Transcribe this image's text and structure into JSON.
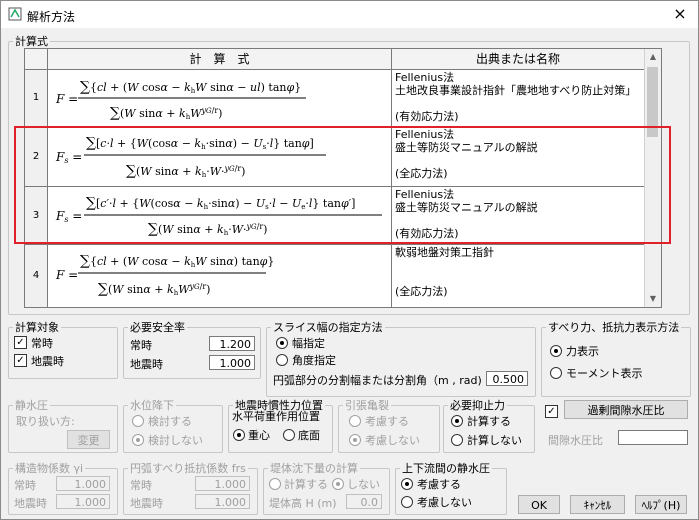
{
  "window": {
    "title": "解析方法",
    "close_symbol": "×"
  },
  "formula_group": {
    "legend": "計算式",
    "col_formula": "計　算　式",
    "col_source": "出典または名称",
    "rows": [
      {
        "no": "1",
        "source": [
          "Fellenius法",
          "土地改良事業設計指針「農地地すべり防止対策」",
          "",
          "(有効応力法)"
        ]
      },
      {
        "no": "2",
        "source": [
          "Fellenius法",
          "盛土等防災マニュアルの解説",
          "",
          "(全応力法)"
        ]
      },
      {
        "no": "3",
        "source": [
          "Fellenius法",
          "盛土等防災マニュアルの解説",
          "",
          "(有効応力法)"
        ]
      },
      {
        "no": "4",
        "source": [
          "軟弱地盤対策工指針",
          "",
          "",
          "(全応力法)"
        ]
      }
    ]
  },
  "target": {
    "legend": "計算対象",
    "normal": "常時",
    "quake": "地震時",
    "normal_checked": true,
    "quake_checked": true
  },
  "safety": {
    "legend": "必要安全率",
    "normal": "常時",
    "normal_value": "1.200",
    "quake": "地震時",
    "quake_value": "1.000"
  },
  "slice": {
    "legend": "スライス幅の指定方法",
    "opt1": "幅指定",
    "opt2": "角度指定",
    "arc_label": "円弧部分の分割幅または分割角（m , rad)",
    "arc_value": "0.500"
  },
  "display": {
    "legend": "すべり力、抵抗力表示方法",
    "opt1": "力表示",
    "opt2": "モーメント表示"
  },
  "static_water": {
    "legend": "静水圧",
    "label": "取り扱い方:",
    "button": "変更"
  },
  "water_drop": {
    "legend": "水位降下",
    "opt1": "検討する",
    "opt2": "検討しない"
  },
  "inertia": {
    "legend": "地震時慣性力位置",
    "sub": "水平荷重作用位置",
    "opt1": "重心",
    "opt2": "底面"
  },
  "tension_crack": {
    "legend": "引張亀裂",
    "opt1": "考慮する",
    "opt2": "考慮しない"
  },
  "resist": {
    "legend": "必要抑止力",
    "opt1": "計算する",
    "opt2": "計算しない"
  },
  "pore": {
    "button": "過剰間隙水圧比",
    "label": "間隙水圧比",
    "checked": true
  },
  "structure": {
    "legend": "構造物係数 γi",
    "normal": "常時",
    "normal_value": "1.000",
    "quake": "地震時",
    "quake_value": "1.000"
  },
  "arc_coef": {
    "legend": "円弧すべり抵抗係数 frs",
    "normal": "常時",
    "normal_value": "1.000",
    "quake": "地震時",
    "quake_value": "1.000"
  },
  "settlement": {
    "legend": "堤体沈下量の計算",
    "opt1": "計算する",
    "opt2": "しない",
    "height_label": "堤体高 H (m)",
    "height_value": "0.0"
  },
  "flow": {
    "legend": "上下流間の静水圧",
    "opt1": "考慮する",
    "opt2": "考慮しない"
  },
  "buttons": {
    "ok": "OK",
    "cancel": "ｷｬﾝｾﾙ",
    "help": "ﾍﾙﾌﾟ(H)"
  },
  "colors": {
    "highlight": "#e0202a"
  }
}
